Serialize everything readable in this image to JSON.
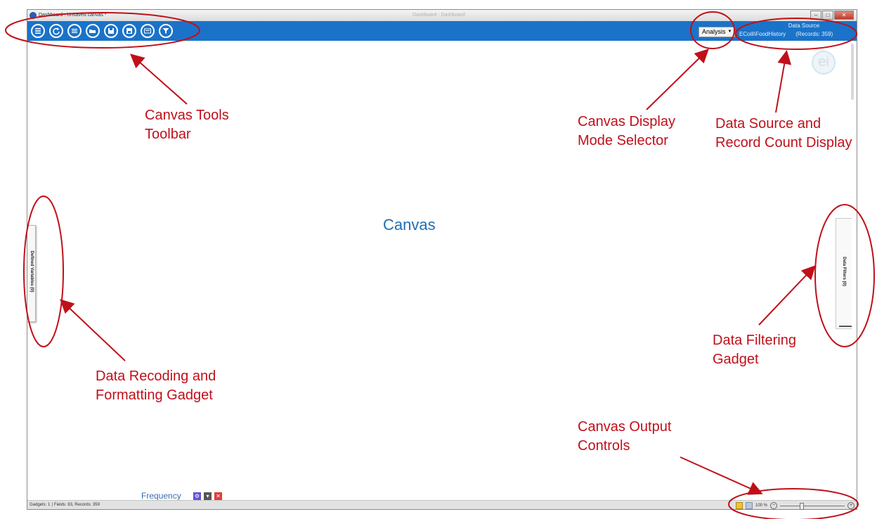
{
  "window": {
    "title": "Dashboard : Unsaved canvas *",
    "center_title": "Dashboard - Dashboard"
  },
  "toolbar": {
    "buttons": [
      "list-icon",
      "refresh-icon",
      "menu-icon",
      "open-folder-icon",
      "save-icon",
      "save-as-icon",
      "export-html-icon",
      "filter-icon"
    ],
    "mode_value": "Analysis",
    "data_source_title": "Data Source",
    "data_source_path": "ECoili\\FoodHistory",
    "records_text": "(Records: 359)"
  },
  "canvas": {
    "label": "Canvas",
    "left_gadget_label": "Defined Variables (0)",
    "right_gadget_label": "Data Filters (0)"
  },
  "gadget_bar": {
    "label": "Frequency"
  },
  "status": {
    "gadgets": "Gadgets: 1",
    "fields": "Fields: 83, Records: 359",
    "zoom": "100 %"
  },
  "annotations": {
    "toolbar": [
      "Canvas Tools",
      "Toolbar"
    ],
    "mode": [
      "Canvas Display",
      "Mode Selector"
    ],
    "datasource": [
      "Data Source and",
      "Record Count Display"
    ],
    "recoding": [
      "Data Recoding and",
      "Formatting Gadget"
    ],
    "filtering": [
      "Data Filtering",
      "Gadget"
    ],
    "output": [
      "Canvas Output",
      "Controls"
    ]
  },
  "colors": {
    "toolbar": "#1a73c9",
    "annotation": "#c0101a",
    "canvas_label": "#1d6fb8"
  }
}
